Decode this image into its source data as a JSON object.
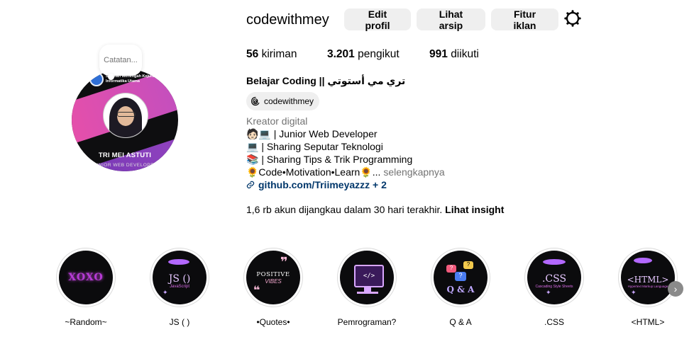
{
  "profile": {
    "avatar_name": "TRI MEI ASTUTI",
    "avatar_role": "JUNIOR WEB DEVELOPER",
    "school_line1": "Sekolah Menengah Kejuruan",
    "school_line2": "Informatika Utama",
    "note": "Catatan..."
  },
  "header": {
    "username": "codewithmey",
    "edit_label": "Edit profil",
    "archive_label": "Lihat arsip",
    "ads_label": "Fitur iklan"
  },
  "stats": {
    "posts_count": "56",
    "posts_label": "kiriman",
    "followers_count": "3.201",
    "followers_label": "pengikut",
    "following_count": "991",
    "following_label": "diikuti"
  },
  "bio": {
    "full_name": "Belajar Coding || تري مي أستوتي",
    "threads_handle": "codewithmey",
    "category": "Kreator digital",
    "line1": "🧑🏻💻 | Junior Web Developer",
    "line2": "💻 | Sharing Seputar Teknologi",
    "line3": "📚 | Sharing Tips & Trik Programming",
    "line4": "🌻Code•Motivation•Learn🌻...",
    "more": "selengkapnya",
    "link": "github.com/Triimeyazzz + 2",
    "insight_text": "1,6 rb akun dijangkau dalam 30 hari terakhir.",
    "insight_link": "Lihat insight"
  },
  "highlights": [
    {
      "label": "~Random~",
      "art": "XOXO"
    },
    {
      "label": "JS ( )",
      "art": "JS ()",
      "sub": "JavaScript"
    },
    {
      "label": "•Quotes•",
      "art": "POSITIVE",
      "sub": "VIBES"
    },
    {
      "label": "Pemrograman?",
      "art": "</>"
    },
    {
      "label": "Q & A",
      "art": "Q & A"
    },
    {
      "label": ".CSS",
      "art": ".CSS",
      "sub": "Cascading Style Sheets"
    },
    {
      "label": "<HTML>",
      "art": "<HTML>",
      "sub": "Hypertext Markup Language"
    }
  ],
  "colors": {
    "button_bg": "#efefef",
    "link": "#00376b",
    "muted": "#737373",
    "accent_pink": "#ec4fa6",
    "accent_purple": "#9b4fe0"
  }
}
